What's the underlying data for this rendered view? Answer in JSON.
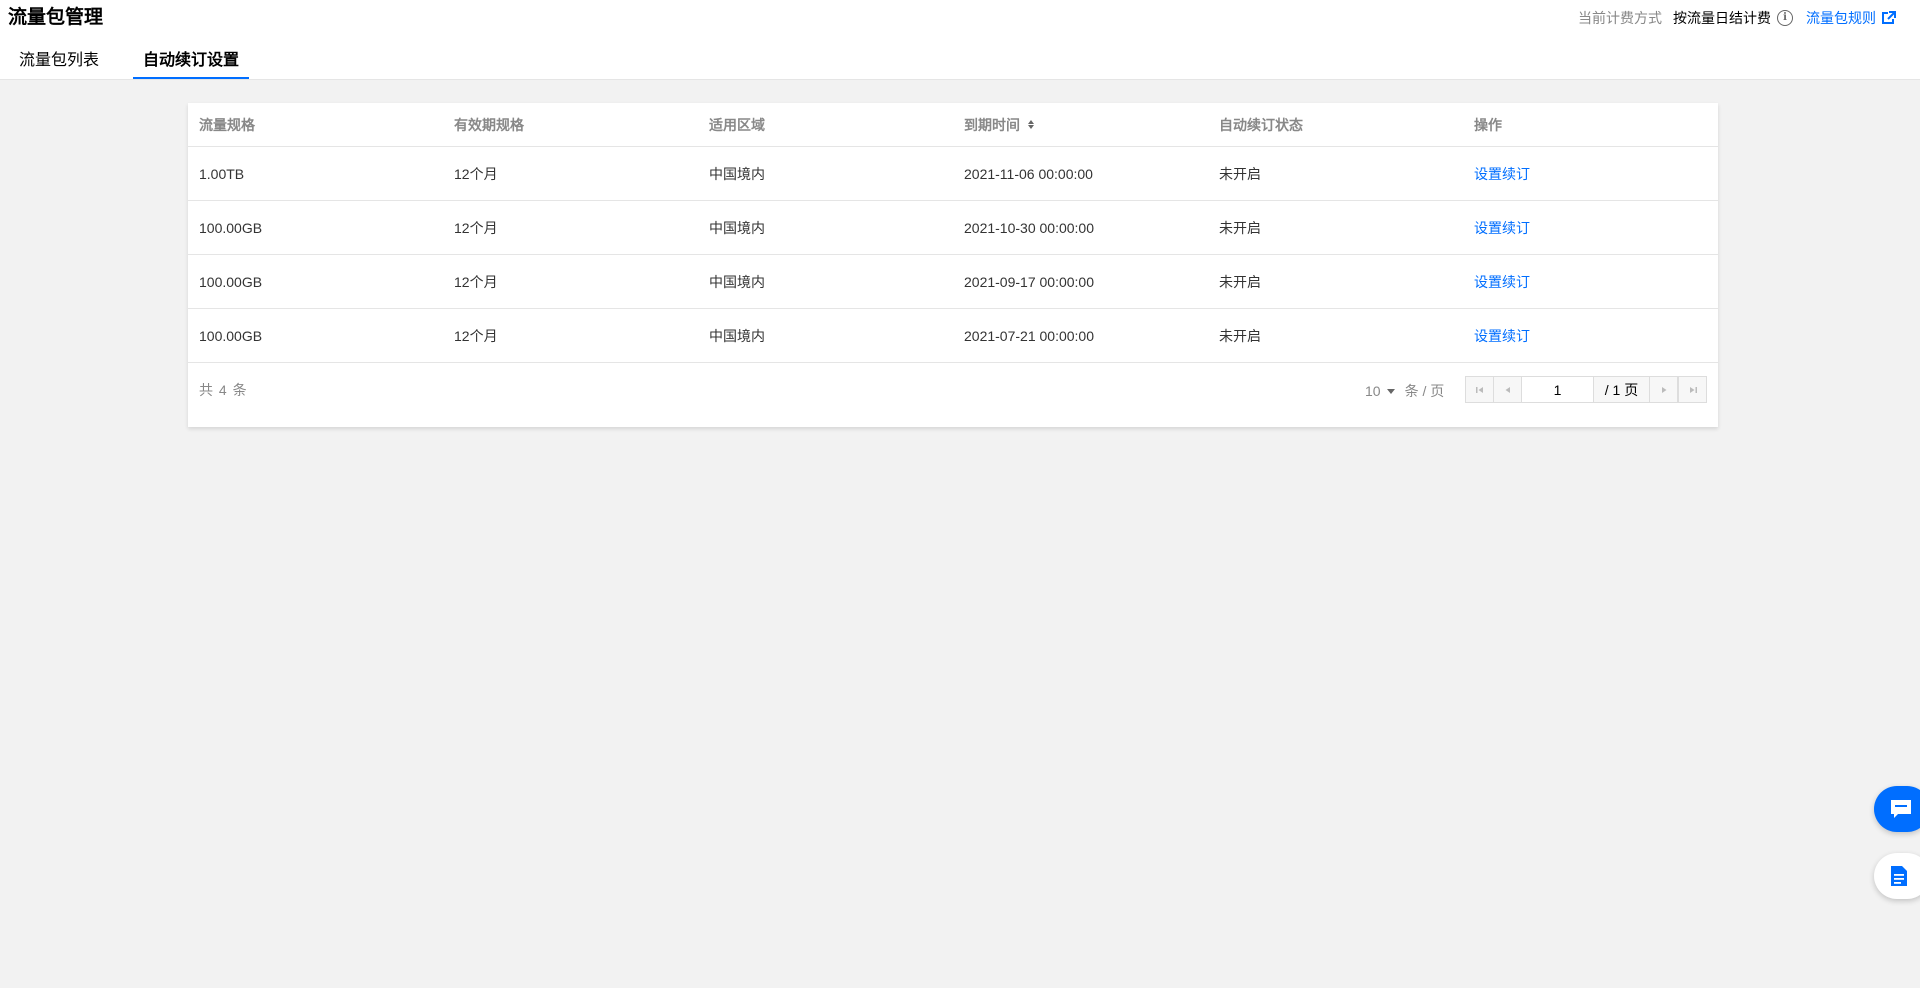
{
  "header": {
    "title": "流量包管理",
    "billing_label": "当前计费方式",
    "billing_value": "按流量日结计费",
    "rules_link": "流量包规则"
  },
  "tabs": [
    {
      "label": "流量包列表",
      "active": false
    },
    {
      "label": "自动续订设置",
      "active": true
    }
  ],
  "table": {
    "columns": [
      "流量规格",
      "有效期规格",
      "适用区域",
      "到期时间",
      "自动续订状态",
      "操作"
    ],
    "rows": [
      {
        "spec": "1.00TB",
        "validity": "12个月",
        "region": "中国境内",
        "expire": "2021-11-06 00:00:00",
        "status": "未开启",
        "action": "设置续订"
      },
      {
        "spec": "100.00GB",
        "validity": "12个月",
        "region": "中国境内",
        "expire": "2021-10-30 00:00:00",
        "status": "未开启",
        "action": "设置续订"
      },
      {
        "spec": "100.00GB",
        "validity": "12个月",
        "region": "中国境内",
        "expire": "2021-09-17 00:00:00",
        "status": "未开启",
        "action": "设置续订"
      },
      {
        "spec": "100.00GB",
        "validity": "12个月",
        "region": "中国境内",
        "expire": "2021-07-21 00:00:00",
        "status": "未开启",
        "action": "设置续订"
      }
    ]
  },
  "pagination": {
    "total_text": "共 4 条",
    "page_size": "10",
    "page_size_unit": "条 / 页",
    "current_page": "1",
    "total_pages_text": "/ 1 页"
  },
  "colors": {
    "accent": "#006eff",
    "background": "#f2f2f2"
  },
  "floating": {
    "chat_icon": "chat-icon",
    "doc_icon": "document-icon"
  }
}
